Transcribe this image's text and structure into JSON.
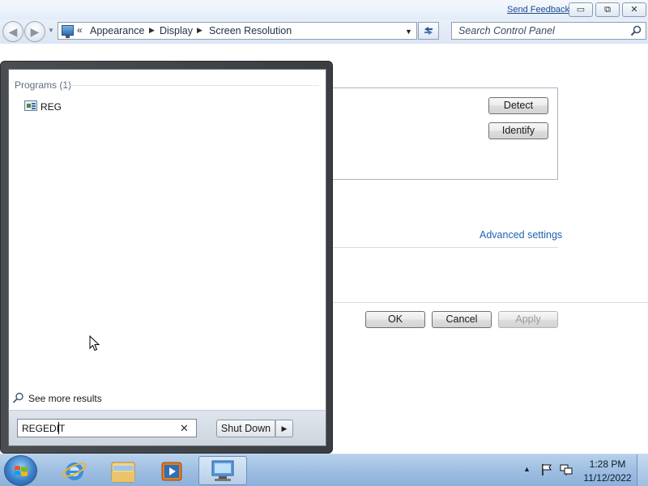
{
  "window": {
    "send_feedback": "Send Feedback",
    "caption_buttons": {
      "minimize": "▭",
      "maximize": "⧉",
      "close": "✕"
    }
  },
  "navigation": {
    "back_glyph": "◀",
    "forward_glyph": "▶",
    "overflow": "«",
    "breadcrumbs": [
      "Appearance",
      "Display",
      "Screen Resolution"
    ],
    "search_placeholder": "Search Control Panel"
  },
  "screen_resolution": {
    "detect_label": "Detect",
    "identify_label": "Identify",
    "advanced_settings_label": "Advanced settings",
    "ok_label": "OK",
    "cancel_label": "Cancel",
    "apply_label": "Apply",
    "apply_enabled": false
  },
  "start_menu": {
    "results_header": "Programs (1)",
    "programs": [
      {
        "label": "REG",
        "icon": "registry-editor-icon"
      }
    ],
    "see_more_label": "See more results",
    "search_value": "REGEDIT",
    "shutdown_label": "Shut Down"
  },
  "taskbar": {
    "pinned": [
      "internet-explorer-icon",
      "windows-explorer-icon",
      "media-player-icon",
      "control-panel-icon"
    ],
    "active": "control-panel-icon",
    "clock_time": "1:28 PM",
    "clock_date": "11/12/2022"
  },
  "colors": {
    "link": "#1e62b3",
    "taskbar": "#a1c0e2",
    "start_menu_frame": "#3a3d41"
  }
}
